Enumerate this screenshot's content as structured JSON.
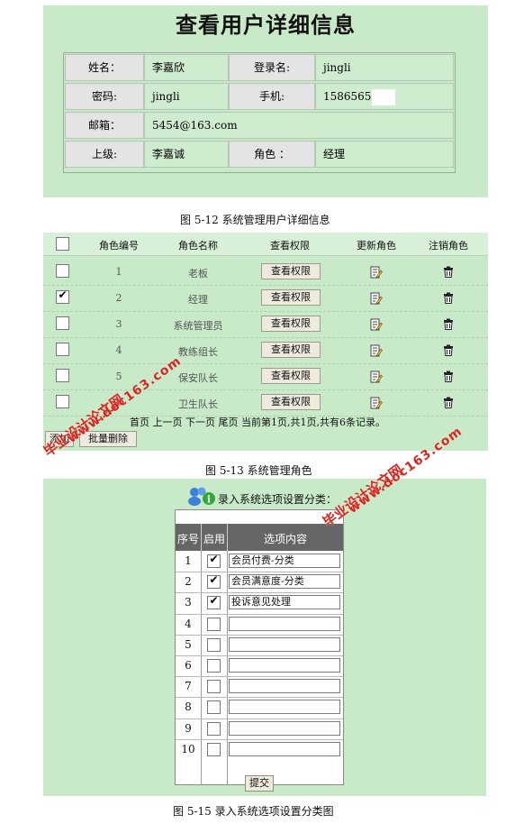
{
  "panel1": {
    "title": "查看用户详细信息",
    "name_label": "姓名：",
    "name_value": "李嘉欣",
    "login_label": "登录名:",
    "login_value": "jingli",
    "password_label": "密码:",
    "password_value": "jingli",
    "phone_label": "手机:",
    "phone_value": "1586565",
    "email_label": "邮箱：",
    "email_value": "5454@163.com",
    "superior_label": "上级:",
    "superior_value": "李嘉诚",
    "role_label": "角色 ：",
    "role_value": "经理"
  },
  "caption1": "图 5-12 系统管理用户详细信息",
  "panel2": {
    "headers": [
      "角色编号",
      "角色名称",
      "查看权限",
      "更新角色",
      "注销角色"
    ],
    "rows": [
      {
        "id": "1",
        "name": "老板",
        "checked": false
      },
      {
        "id": "2",
        "name": "经理",
        "checked": true
      },
      {
        "id": "3",
        "name": "系统管理员",
        "checked": false
      },
      {
        "id": "4",
        "name": "教练组长",
        "checked": false
      },
      {
        "id": "5",
        "name": "保安队长",
        "checked": false
      },
      {
        "id": "6",
        "name": "卫生队长",
        "checked": false
      }
    ],
    "view_permission_label": "查看权限",
    "pager": "首页  上一页  下一页  尾页  当前第1页,共1页,共有6条记录。",
    "add_button": "添加",
    "batch_delete_button": "批量删除"
  },
  "caption2": "图 5-13 系统管理角色",
  "panel3": {
    "title": "录入系统选项设置分类：",
    "headers": [
      "序号",
      "启用",
      "选项内容"
    ],
    "rows": [
      {
        "index": "1",
        "enabled": true,
        "content": "会员付费-分类"
      },
      {
        "index": "2",
        "enabled": true,
        "content": "会员满意度-分类"
      },
      {
        "index": "3",
        "enabled": true,
        "content": "投诉意见处理"
      },
      {
        "index": "4",
        "enabled": false,
        "content": ""
      },
      {
        "index": "5",
        "enabled": false,
        "content": ""
      },
      {
        "index": "6",
        "enabled": false,
        "content": ""
      },
      {
        "index": "7",
        "enabled": false,
        "content": ""
      },
      {
        "index": "8",
        "enabled": false,
        "content": ""
      },
      {
        "index": "9",
        "enabled": false,
        "content": ""
      },
      {
        "index": "10",
        "enabled": false,
        "content": ""
      }
    ],
    "submit_button": "提交"
  },
  "caption3": "图 5-15 录入系统选项设置分类图",
  "watermarks": {
    "cn": "毕业设计论文网",
    "url": "www.doc163.com"
  },
  "colors": {
    "panel_bg": "#c8eac8",
    "watermark": "#d8251e",
    "table_header": "#666666"
  }
}
